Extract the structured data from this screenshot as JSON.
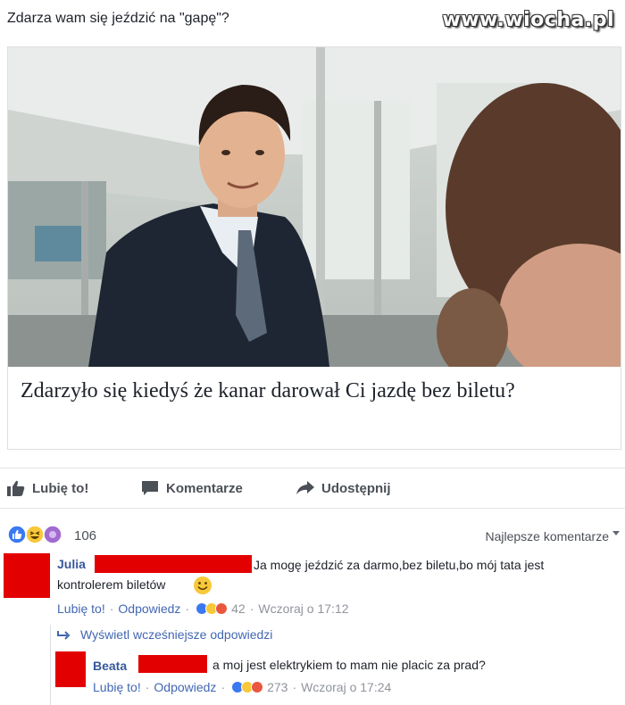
{
  "post": {
    "title": "Zdarza wam się jeździć na \"gapę\"?",
    "watermark": "www.wiocha.pl"
  },
  "card": {
    "caption": "Zdarzyło się kiedyś że kanar darował Ci jazdę bez biletu?"
  },
  "actions": {
    "like": "Lubię to!",
    "comment": "Komentarze",
    "share": "Udostępnij"
  },
  "reactions": {
    "count": "106",
    "sort": "Najlepsze komentarze"
  },
  "comments": [
    {
      "author": "Julia",
      "text_line1": "Ja mogę jeździć za darmo,bez biletu,bo mój tata jest",
      "text_line2": "kontrolerem biletów",
      "like": "Lubię to!",
      "reply": "Odpowiedz",
      "reaction_count": "42",
      "time": "Wczoraj o 17:12"
    }
  ],
  "replies": {
    "view_previous": "Wyświetl wcześniejsze odpowiedzi",
    "items": [
      {
        "author": "Beata",
        "text": "a moj jest elektrykiem to mam nie placic za prad?",
        "like": "Lubię to!",
        "reply": "Odpowiedz",
        "reaction_count": "273",
        "time": "Wczoraj o 17:24"
      }
    ]
  },
  "colors": {
    "link": "#4267b2",
    "author": "#365899",
    "redaction": "#e30000",
    "like_blue": "#3b79f2",
    "haha_yellow": "#f7c83a",
    "angry_red": "#e9573f",
    "wow_purple": "#a06ad0"
  }
}
